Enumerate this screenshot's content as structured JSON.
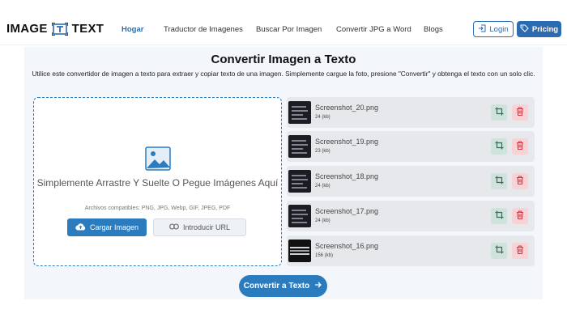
{
  "header": {
    "logo_left": "IMAGE",
    "logo_right": "TEXT",
    "nav": [
      {
        "label": "Hogar",
        "active": true
      },
      {
        "label": "Traductor de Imagenes",
        "active": false
      },
      {
        "label": "Buscar Por Imagen",
        "active": false
      },
      {
        "label": "Convertir JPG a Word",
        "active": false
      },
      {
        "label": "Blogs",
        "active": false
      }
    ],
    "login_label": "Login",
    "pricing_label": "Pricing"
  },
  "main": {
    "title": "Convertir Imagen a Texto",
    "subtitle": "Utilice este convertidor de imagen a texto para extraer y copiar texto de una imagen. Simplemente cargue la foto, presione \"Convertir\" y obtenga el texto con un solo clic.",
    "dropzone": {
      "title": "Simplemente Arrastre Y Suelte O Pegue Imágenes Aquí",
      "formats": "Archivos compatibles: PNG, JPG, Webp, GIF, JPEG, PDF",
      "upload_label": "Cargar Imagen",
      "url_label": "Introducir URL"
    },
    "files": [
      {
        "name": "Screenshot_20.png",
        "size": "24 (kb)"
      },
      {
        "name": "Screenshot_19.png",
        "size": "23 (kb)"
      },
      {
        "name": "Screenshot_18.png",
        "size": "24 (kb)"
      },
      {
        "name": "Screenshot_17.png",
        "size": "24 (kb)"
      },
      {
        "name": "Screenshot_16.png",
        "size": "156 (kb)"
      }
    ],
    "convert_label": "Convertir a Texto"
  },
  "colors": {
    "accent": "#2b7bbf",
    "nav_active": "#2b6cb0",
    "crop_bg": "#cfe3dc",
    "delete_bg": "#f7d3d6"
  },
  "icons": [
    "logo-text-icon",
    "login-icon",
    "pricing-icon",
    "image-icon",
    "cloud-upload-icon",
    "link-icon",
    "crop-icon",
    "trash-icon",
    "arrow-right-icon"
  ]
}
